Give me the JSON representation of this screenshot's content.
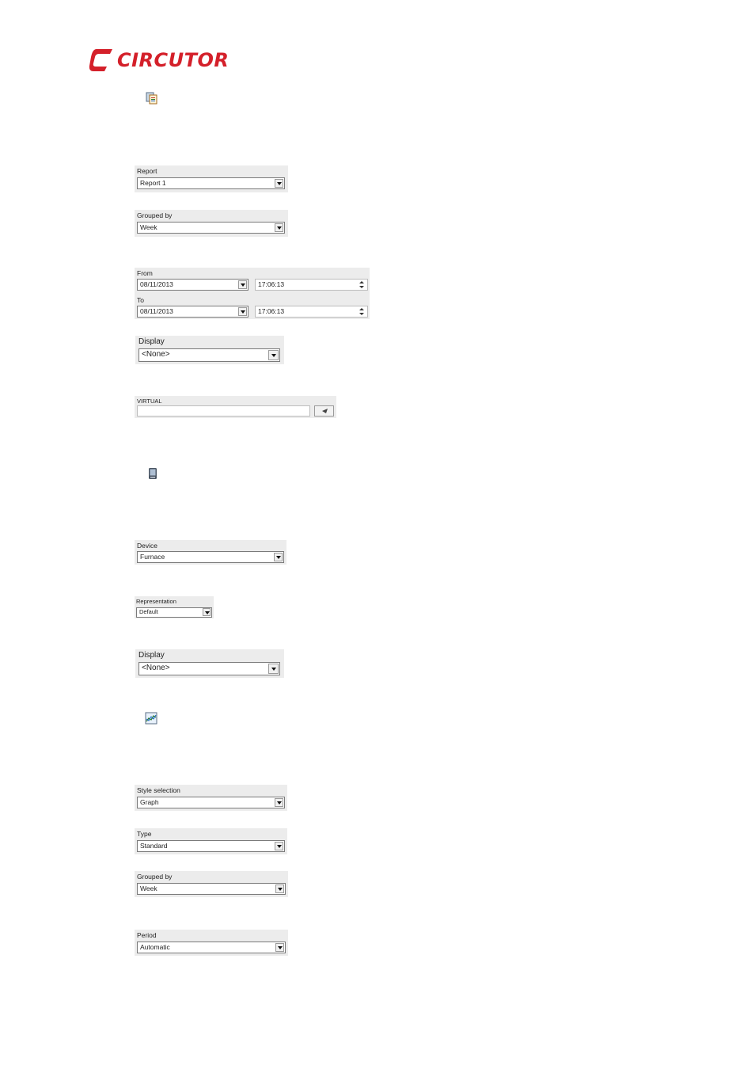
{
  "brand": {
    "name": "CIRCUTOR",
    "color": "#d4202a"
  },
  "icons": {
    "report_icon": "report-icon",
    "device_icon": "device-icon",
    "graph_icon": "graph-icon"
  },
  "report_section": {
    "report": {
      "label": "Report",
      "value": "Report 1"
    },
    "grouped_by": {
      "label": "Grouped by",
      "value": "Week"
    },
    "date_range": {
      "from_label": "From",
      "from_date": "08/11/2013",
      "from_time": "17:06:13",
      "to_label": "To",
      "to_date": "08/11/2013",
      "to_time": "17:06:13"
    },
    "display": {
      "label": "Display",
      "value": "<None>"
    },
    "virtual": {
      "label": "VIRTUAL",
      "value": ""
    }
  },
  "device_section": {
    "device": {
      "label": "Device",
      "value": "Furnace"
    },
    "representation": {
      "label": "Representation",
      "value": "Default"
    },
    "display": {
      "label": "Display",
      "value": "<None>"
    }
  },
  "graph_section": {
    "style_selection": {
      "label": "Style selection",
      "value": "Graph"
    },
    "type": {
      "label": "Type",
      "value": "Standard"
    },
    "grouped_by": {
      "label": "Grouped by",
      "value": "Week"
    },
    "period": {
      "label": "Period",
      "value": "Automatic"
    }
  }
}
